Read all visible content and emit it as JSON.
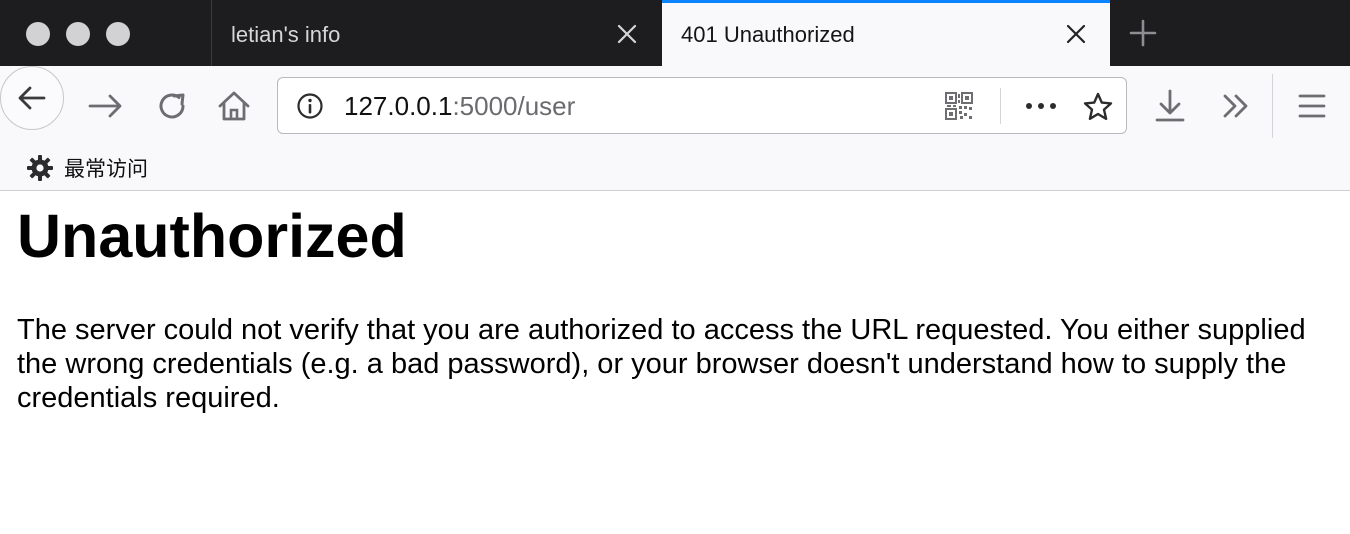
{
  "browser": {
    "tabs": [
      {
        "label": "letian's info",
        "active": false
      },
      {
        "label": "401 Unauthorized",
        "active": true
      }
    ],
    "url": {
      "host": "127.0.0.1",
      "rest": ":5000/user"
    },
    "bookmarks": [
      {
        "label": "最常访问",
        "icon": "gear-icon"
      }
    ],
    "colors": {
      "tab_strip": "#1d1d1f",
      "active_tab_accent": "#0a84ff",
      "toolbar": "#f9f9fb"
    }
  },
  "page": {
    "heading": "Unauthorized",
    "body": "The server could not verify that you are authorized to access the URL requested. You either supplied the wrong credentials (e.g. a bad password), or your browser doesn't understand how to supply the credentials required."
  }
}
